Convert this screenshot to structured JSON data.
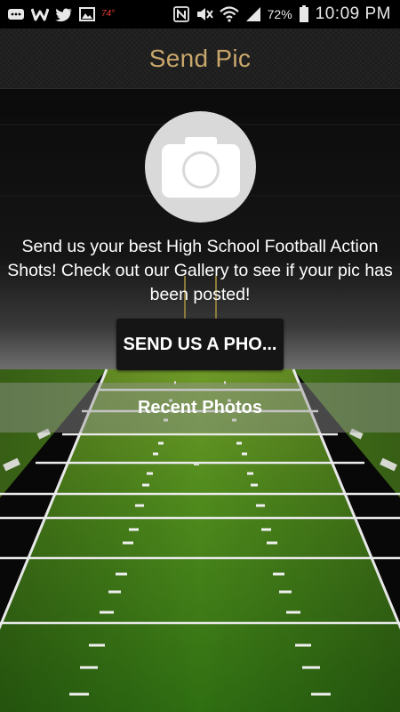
{
  "status_bar": {
    "temperature": "74°",
    "battery": "72%",
    "time": "10:09 PM",
    "icons": [
      "message-icon",
      "w-app-icon",
      "twitter-icon",
      "image-icon",
      "weather-icon",
      "nfc-icon",
      "mute-icon",
      "wifi-icon",
      "signal-icon",
      "battery-icon"
    ]
  },
  "header": {
    "title": "Send Pic",
    "title_color": "#c9a76b"
  },
  "main": {
    "camera_icon": "camera-icon",
    "description": "Send us your best High School Football Action Shots! Check out our Gallery to see if your pic has been posted!",
    "send_button_label": "SEND US A PHO...",
    "recent_photos_title": "Recent Photos"
  }
}
